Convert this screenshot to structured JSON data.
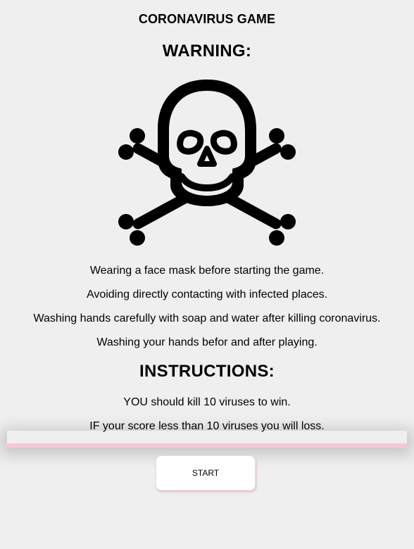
{
  "title": "CORONAVIRUS GAME",
  "warning": {
    "heading": "WARNING:",
    "icon": "skull-crossbones-icon",
    "lines": [
      "Wearing a face mask before starting the game.",
      "Avoiding directly contacting with infected places.",
      "Washing hands carefully with soap and water after killing coronavirus.",
      "Washing your hands befor and after playing."
    ]
  },
  "instructions": {
    "heading": "INSTRUCTIONS:",
    "lines": [
      "YOU should kill 10 viruses to win.",
      "IF your score less than 10 viruses you will loss."
    ]
  },
  "start_label": "START",
  "colors": {
    "background": "#efefef",
    "divider": "#f5c8d6",
    "button": "#ffffff"
  }
}
